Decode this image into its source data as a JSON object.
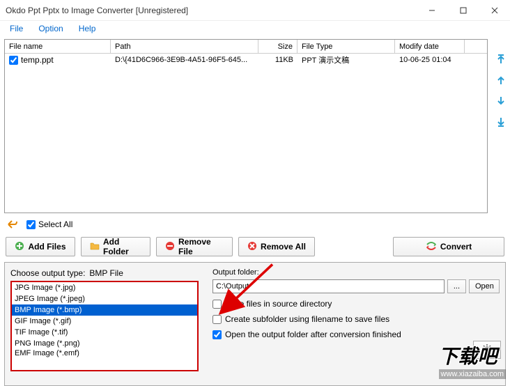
{
  "window": {
    "title": "Okdo Ppt Pptx to Image Converter [Unregistered]"
  },
  "menu": {
    "file": "File",
    "option": "Option",
    "help": "Help"
  },
  "list": {
    "headers": {
      "name": "File name",
      "path": "Path",
      "size": "Size",
      "type": "File Type",
      "date": "Modify date"
    },
    "row": {
      "name": "temp.ppt",
      "path": "D:\\{41D6C966-3E9B-4A51-96F5-645...",
      "size": "11KB",
      "type": "PPT 演示文稿",
      "date": "10-06-25 01:04"
    }
  },
  "toolbar": {
    "selectall": "Select All",
    "addfiles": "Add Files",
    "addfolder": "Add Folder",
    "removefile": "Remove File",
    "removeall": "Remove All",
    "convert": "Convert"
  },
  "output": {
    "type_label": "Choose output type:",
    "type_current": "BMP File",
    "types": {
      "jpg": "JPG Image (*.jpg)",
      "jpeg": "JPEG Image (*.jpeg)",
      "bmp": "BMP Image (*.bmp)",
      "gif": "GIF Image (*.gif)",
      "tif": "TIF Image (*.tif)",
      "png": "PNG Image (*.png)",
      "emf": "EMF Image (*.emf)"
    },
    "folder_label": "Output folder:",
    "folder_value": "C:\\Output",
    "browse": "...",
    "open": "Open",
    "cb_source": "Save files in source directory",
    "cb_subfolder": "Create subfolder using filename to save files",
    "cb_openafter": "Open the output folder after conversion finished"
  },
  "watermark": {
    "text1": "下载吧",
    "text2": "www.xiazaiba.com"
  }
}
